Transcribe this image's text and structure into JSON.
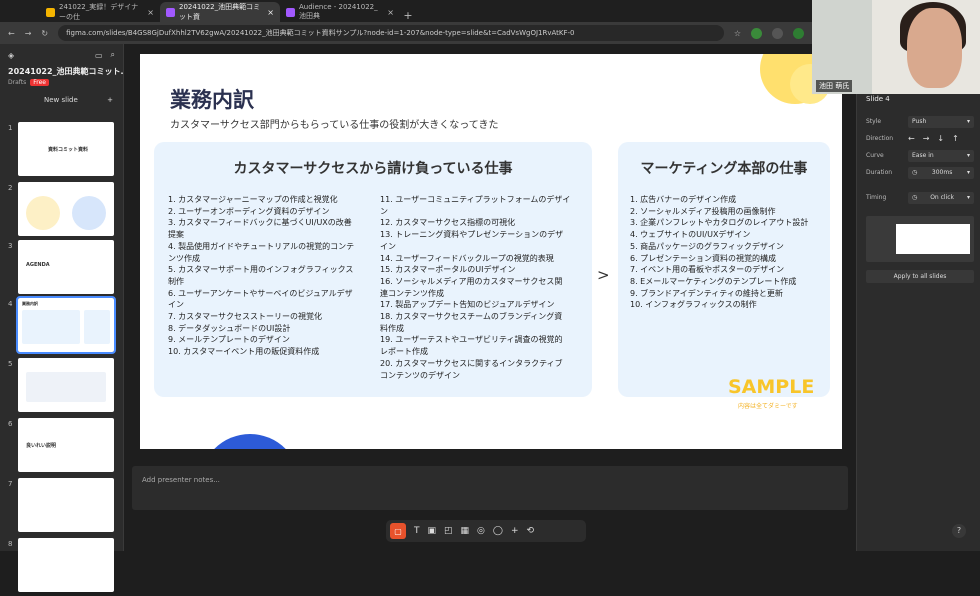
{
  "browser": {
    "tabs": [
      {
        "title": "241022_実録！デザイナーの仕"
      },
      {
        "title": "20241022_池田典範コミット資"
      },
      {
        "title": "Audience - 20241022_池田典"
      }
    ],
    "url": "figma.com/slides/B4GS8GjDufXhhl2TV62gwA/20241022_池田典範コミット資料サンプル?node-id=1-207&node-type=slide&t=CadVsWgOJ1RvAtKF-0"
  },
  "sidebar": {
    "file_name": "20241022_池田典範コミット...",
    "drafts": "Drafts",
    "free": "Free",
    "new_slide": "New slide",
    "slides": [
      {
        "num": "1",
        "title": "資料コミット資料"
      },
      {
        "num": "2",
        "title": ""
      },
      {
        "num": "3",
        "title": "AGENDA"
      },
      {
        "num": "4",
        "title": "業務内訳"
      },
      {
        "num": "5",
        "title": ""
      },
      {
        "num": "6",
        "title": "良いれい説明"
      },
      {
        "num": "7",
        "title": ""
      },
      {
        "num": "8",
        "title": ""
      }
    ]
  },
  "slide": {
    "title": "業務内訳",
    "subtitle": "カスタマーサクセス部門からもらっている仕事の役割が大きくなってきた",
    "left_heading": "カスタマーサクセスから請け負っている仕事",
    "left_col1": [
      "1. カスタマージャーニーマップの作成と視覚化",
      "2. ユーザーオンボーディング資料のデザイン",
      "3. カスタマーフィードバックに基づくUI/UXの改善",
      "提案",
      "4. 製品使用ガイドやチュートリアルの視覚的コンテ",
      "ンツ作成",
      "5. カスタマーサポート用のインフォグラフィックス",
      "制作",
      "6. ユーザーアンケートやサーベイのビジュアルデザ",
      "イン",
      "7. カスタマーサクセスストーリーの視覚化",
      "8. データダッシュボードのUI設計",
      "9. メールテンプレートのデザイン",
      "10. カスタマーイベント用の販促資料作成"
    ],
    "left_col2": [
      "11. ユーザーコミュニティプラットフォームのデザイ",
      "ン",
      "12. カスタマーサクセス指標の可視化",
      "13. トレーニング資料やプレゼンテーションのデザ",
      "イン",
      "14. ユーザーフィードバックループの視覚的表現",
      "15. カスタマーポータルのUIデザイン",
      "16. ソーシャルメディア用のカスタマーサクセス関",
      "連コンテンツ作成",
      "17. 製品アップデート告知のビジュアルデザイン",
      "18. カスタマーサクセスチームのブランディング資",
      "料作成",
      "19. ユーザーテストやユーザビリティ調査の視覚的",
      "レポート作成",
      "20. カスタマーサクセスに関するインタラクティブ",
      "コンテンツのデザイン"
    ],
    "arrow": ">",
    "right_heading": "マーケティング本部の仕事",
    "right_list": [
      "1. 広告バナーのデザイン作成",
      "2. ソーシャルメディア投稿用の画像制作",
      "3. 企業パンフレットやカタログのレイアウト設計",
      "4. ウェブサイトのUI/UXデザイン",
      "5. 商品パッケージのグラフィックデザイン",
      "6. プレゼンテーション資料の視覚的構成",
      "7. イベント用の看板やポスターのデザイン",
      "8. Eメールマーケティングのテンプレート作成",
      "9. ブランドアイデンティティの維持と更新",
      "10. インフォグラフィックスの制作"
    ],
    "sample": "SAMPLE",
    "sample_sub": "内容は全てダミーです"
  },
  "notes": {
    "placeholder": "Add presenter notes..."
  },
  "video": {
    "name": "池田 萌氏"
  },
  "right_panel": {
    "title": "Slide 4",
    "style_label": "Style",
    "style_value": "Push",
    "direction_label": "Direction",
    "curve_label": "Curve",
    "curve_value": "Ease in",
    "duration_label": "Duration",
    "duration_value": "300ms",
    "timing_label": "Timing",
    "timing_value": "On click",
    "apply": "Apply to all slides"
  },
  "colors": {
    "accent": "#4a8cff",
    "sample": "#f8c52a",
    "box": "#e9f3fd",
    "tool_active": "#e8522c"
  }
}
